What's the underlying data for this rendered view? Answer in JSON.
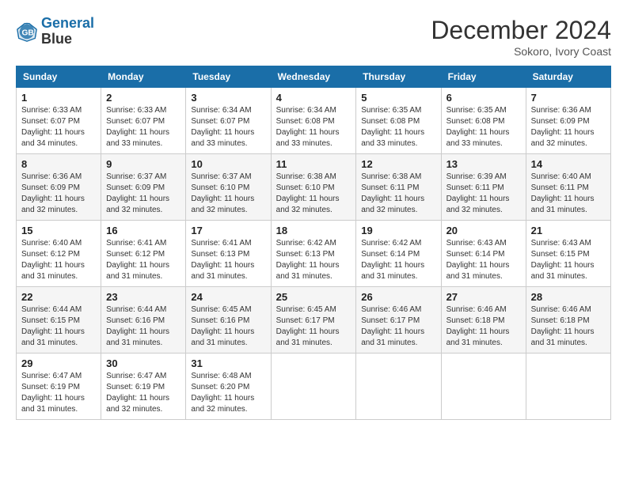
{
  "header": {
    "logo_line1": "General",
    "logo_line2": "Blue",
    "month_title": "December 2024",
    "location": "Sokoro, Ivory Coast"
  },
  "days_of_week": [
    "Sunday",
    "Monday",
    "Tuesday",
    "Wednesday",
    "Thursday",
    "Friday",
    "Saturday"
  ],
  "weeks": [
    [
      {
        "day": "1",
        "sunrise": "6:33 AM",
        "sunset": "6:07 PM",
        "daylight": "11 hours and 34 minutes."
      },
      {
        "day": "2",
        "sunrise": "6:33 AM",
        "sunset": "6:07 PM",
        "daylight": "11 hours and 33 minutes."
      },
      {
        "day": "3",
        "sunrise": "6:34 AM",
        "sunset": "6:07 PM",
        "daylight": "11 hours and 33 minutes."
      },
      {
        "day": "4",
        "sunrise": "6:34 AM",
        "sunset": "6:08 PM",
        "daylight": "11 hours and 33 minutes."
      },
      {
        "day": "5",
        "sunrise": "6:35 AM",
        "sunset": "6:08 PM",
        "daylight": "11 hours and 33 minutes."
      },
      {
        "day": "6",
        "sunrise": "6:35 AM",
        "sunset": "6:08 PM",
        "daylight": "11 hours and 33 minutes."
      },
      {
        "day": "7",
        "sunrise": "6:36 AM",
        "sunset": "6:09 PM",
        "daylight": "11 hours and 32 minutes."
      }
    ],
    [
      {
        "day": "8",
        "sunrise": "6:36 AM",
        "sunset": "6:09 PM",
        "daylight": "11 hours and 32 minutes."
      },
      {
        "day": "9",
        "sunrise": "6:37 AM",
        "sunset": "6:09 PM",
        "daylight": "11 hours and 32 minutes."
      },
      {
        "day": "10",
        "sunrise": "6:37 AM",
        "sunset": "6:10 PM",
        "daylight": "11 hours and 32 minutes."
      },
      {
        "day": "11",
        "sunrise": "6:38 AM",
        "sunset": "6:10 PM",
        "daylight": "11 hours and 32 minutes."
      },
      {
        "day": "12",
        "sunrise": "6:38 AM",
        "sunset": "6:11 PM",
        "daylight": "11 hours and 32 minutes."
      },
      {
        "day": "13",
        "sunrise": "6:39 AM",
        "sunset": "6:11 PM",
        "daylight": "11 hours and 32 minutes."
      },
      {
        "day": "14",
        "sunrise": "6:40 AM",
        "sunset": "6:11 PM",
        "daylight": "11 hours and 31 minutes."
      }
    ],
    [
      {
        "day": "15",
        "sunrise": "6:40 AM",
        "sunset": "6:12 PM",
        "daylight": "11 hours and 31 minutes."
      },
      {
        "day": "16",
        "sunrise": "6:41 AM",
        "sunset": "6:12 PM",
        "daylight": "11 hours and 31 minutes."
      },
      {
        "day": "17",
        "sunrise": "6:41 AM",
        "sunset": "6:13 PM",
        "daylight": "11 hours and 31 minutes."
      },
      {
        "day": "18",
        "sunrise": "6:42 AM",
        "sunset": "6:13 PM",
        "daylight": "11 hours and 31 minutes."
      },
      {
        "day": "19",
        "sunrise": "6:42 AM",
        "sunset": "6:14 PM",
        "daylight": "11 hours and 31 minutes."
      },
      {
        "day": "20",
        "sunrise": "6:43 AM",
        "sunset": "6:14 PM",
        "daylight": "11 hours and 31 minutes."
      },
      {
        "day": "21",
        "sunrise": "6:43 AM",
        "sunset": "6:15 PM",
        "daylight": "11 hours and 31 minutes."
      }
    ],
    [
      {
        "day": "22",
        "sunrise": "6:44 AM",
        "sunset": "6:15 PM",
        "daylight": "11 hours and 31 minutes."
      },
      {
        "day": "23",
        "sunrise": "6:44 AM",
        "sunset": "6:16 PM",
        "daylight": "11 hours and 31 minutes."
      },
      {
        "day": "24",
        "sunrise": "6:45 AM",
        "sunset": "6:16 PM",
        "daylight": "11 hours and 31 minutes."
      },
      {
        "day": "25",
        "sunrise": "6:45 AM",
        "sunset": "6:17 PM",
        "daylight": "11 hours and 31 minutes."
      },
      {
        "day": "26",
        "sunrise": "6:46 AM",
        "sunset": "6:17 PM",
        "daylight": "11 hours and 31 minutes."
      },
      {
        "day": "27",
        "sunrise": "6:46 AM",
        "sunset": "6:18 PM",
        "daylight": "11 hours and 31 minutes."
      },
      {
        "day": "28",
        "sunrise": "6:46 AM",
        "sunset": "6:18 PM",
        "daylight": "11 hours and 31 minutes."
      }
    ],
    [
      {
        "day": "29",
        "sunrise": "6:47 AM",
        "sunset": "6:19 PM",
        "daylight": "11 hours and 31 minutes."
      },
      {
        "day": "30",
        "sunrise": "6:47 AM",
        "sunset": "6:19 PM",
        "daylight": "11 hours and 32 minutes."
      },
      {
        "day": "31",
        "sunrise": "6:48 AM",
        "sunset": "6:20 PM",
        "daylight": "11 hours and 32 minutes."
      },
      null,
      null,
      null,
      null
    ]
  ]
}
